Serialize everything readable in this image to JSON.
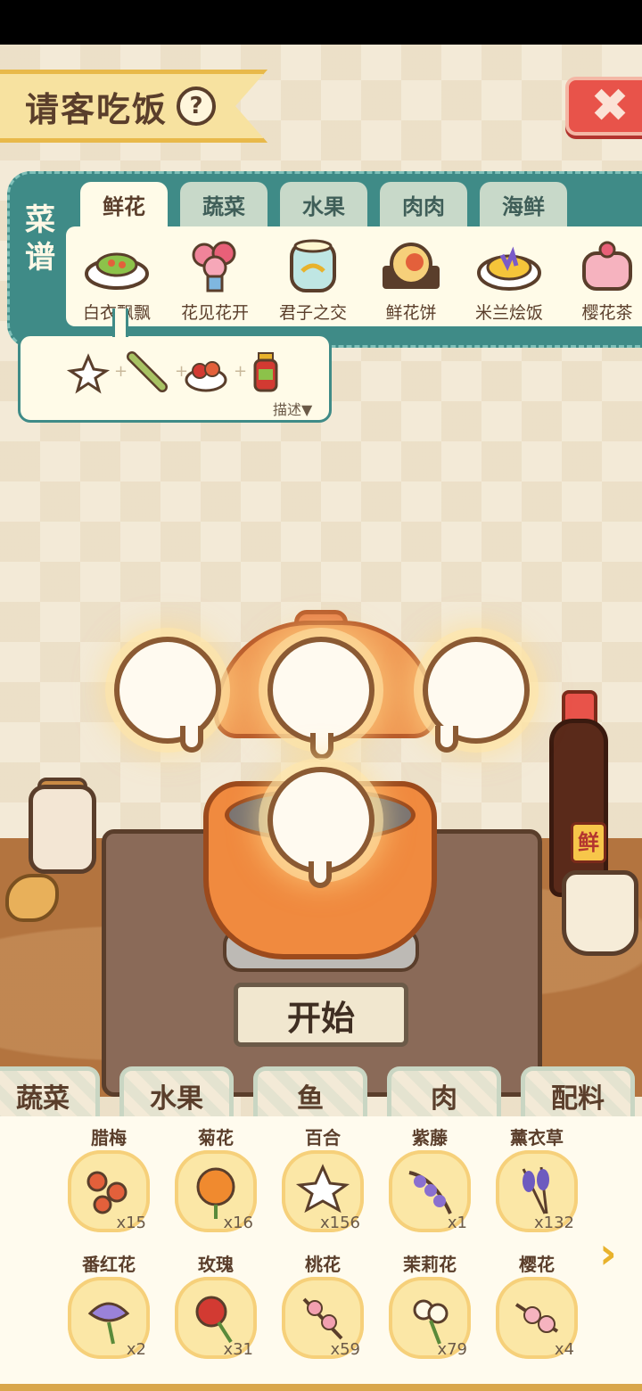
{
  "header": {
    "title": "请客吃饭",
    "help_label": "?",
    "close_label": "✖"
  },
  "recipe": {
    "side_label_1": "菜",
    "side_label_2": "谱",
    "tabs": [
      {
        "label": "鲜花",
        "active": true
      },
      {
        "label": "蔬菜",
        "active": false
      },
      {
        "label": "水果",
        "active": false
      },
      {
        "label": "肉肉",
        "active": false
      },
      {
        "label": "海鲜",
        "active": false
      }
    ],
    "dishes": [
      {
        "name": "白衣飘飘",
        "icon": "salad-plate-icon"
      },
      {
        "name": "花见花开",
        "icon": "flower-bouquet-icon"
      },
      {
        "name": "君子之交",
        "icon": "jelly-cake-icon"
      },
      {
        "name": "鲜花饼",
        "icon": "flower-pastry-icon"
      },
      {
        "name": "米兰烩饭",
        "icon": "risotto-icon"
      },
      {
        "name": "樱花茶",
        "icon": "sakura-tea-icon"
      }
    ],
    "selected_ingredients": [
      "lily-icon",
      "asparagus-icon",
      "goji-icon",
      "sauce-bottle-icon"
    ],
    "describe_label": "描述▼"
  },
  "kitchen": {
    "start_label": "开始",
    "bottle_label": "鲜"
  },
  "categories": [
    {
      "label": "蔬菜",
      "active": false
    },
    {
      "label": "水果",
      "active": false
    },
    {
      "label": "鱼",
      "active": false
    },
    {
      "label": "肉",
      "active": false
    },
    {
      "label": "配料",
      "active": false
    }
  ],
  "inventory": [
    {
      "name": "腊梅",
      "count": "x15",
      "color": "#e3603b"
    },
    {
      "name": "菊花",
      "count": "x16",
      "color": "#f08a2f"
    },
    {
      "name": "百合",
      "count": "x156",
      "color": "#ffffff"
    },
    {
      "name": "紫藤",
      "count": "x1",
      "color": "#8a6fcf"
    },
    {
      "name": "薰衣草",
      "count": "x132",
      "color": "#6d5bbf"
    },
    {
      "name": "番红花",
      "count": "x2",
      "color": "#9a82d8"
    },
    {
      "name": "玫瑰",
      "count": "x31",
      "color": "#d23a32"
    },
    {
      "name": "桃花",
      "count": "x59",
      "color": "#f2a0b0"
    },
    {
      "name": "茉莉花",
      "count": "x79",
      "color": "#fffbe8"
    },
    {
      "name": "樱花",
      "count": "x4",
      "color": "#f6b3bf"
    }
  ],
  "next_label": "›"
}
